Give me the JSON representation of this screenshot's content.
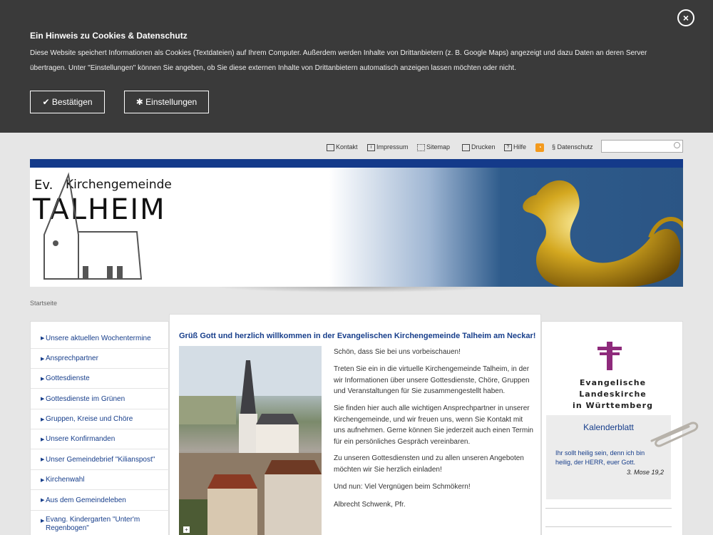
{
  "cookie": {
    "title": "Ein Hinweis zu Cookies & Datenschutz",
    "text": "Diese Website speichert Informationen als Cookies (Textdateien) auf Ihrem Computer. Außerdem werden Inhalte von Drittanbietern (z. B. Google Maps) angezeigt und dazu Daten an deren Server übertragen. Unter \"Einstellungen\" können Sie angeben, ob Sie diese externen Inhalte von Drittanbietern automatisch anzeigen lassen möchten oder nicht.",
    "confirm_label": "Bestätigen",
    "settings_label": "Einstellungen",
    "close_symbol": "×"
  },
  "toolbar": {
    "kontakt": "Kontakt",
    "impressum": "Impressum",
    "sitemap": "Sitemap",
    "drucken": "Drucken",
    "hilfe": "Hilfe",
    "datenschutz": "§ Datenschutz",
    "search_value": ""
  },
  "header": {
    "logo_ev": "Ev.",
    "logo_name": "Kirchengemeinde",
    "logo_big": "TALHEIM"
  },
  "breadcrumb": "Startseite",
  "nav": {
    "items": [
      {
        "label": "Unsere aktuellen Wochentermine"
      },
      {
        "label": "Ansprechpartner"
      },
      {
        "label": "Gottesdienste"
      },
      {
        "label": "Gottesdienste im Grünen"
      },
      {
        "label": "Gruppen, Kreise und Chöre"
      },
      {
        "label": "Unsere Konfirmanden"
      },
      {
        "label": "Unser Gemeindebrief \"Kilianspost\""
      },
      {
        "label": "Kirchenwahl"
      },
      {
        "label": "Aus dem Gemeindeleben"
      },
      {
        "label": "Evang. Kindergarten \"Unter'm Regenbogen\""
      }
    ]
  },
  "main": {
    "title": "Grüß Gott und herzlich willkommen in der Evangelischen Kirchengemeinde Talheim am Neckar!",
    "p1": "Schön, dass Sie bei uns vorbeischauen!",
    "p2": "Treten Sie ein in die virtuelle Kirchengemeinde Talheim, in der wir Informationen über unsere Gottesdienste, Chöre, Gruppen und Veranstaltungen für Sie zusammengestellt haben.",
    "p3": "Sie finden hier auch alle wichtigen Ansprechpartner in unserer Kirchengemeinde, und wir freuen uns, wenn Sie Kontakt mit uns aufnehmen. Gerne können Sie jederzeit auch einen Termin für ein persönliches Gespräch vereinbaren.",
    "p4": "Zu unseren Gottesdiensten und zu allen unseren Angeboten möchten wir Sie herzlich einladen!",
    "p5": "Und nun: Viel Vergnügen beim Schmökern!",
    "p6": "Albrecht Schwenk, Pfr.",
    "photo_plus": "+"
  },
  "right": {
    "elk_line1": "Evangelische Landeskirche",
    "elk_line2": "in Württemberg",
    "kal_title": "Kalenderblatt",
    "kal_verse": "Ihr sollt heilig sein, denn ich bin heilig, der HERR, euer Gott.",
    "kal_ref": "3. Mose 19,2"
  },
  "colors": {
    "accent": "#173e8b",
    "cookie_bg": "#3a3a3a",
    "cross": "#8e2a7b"
  }
}
